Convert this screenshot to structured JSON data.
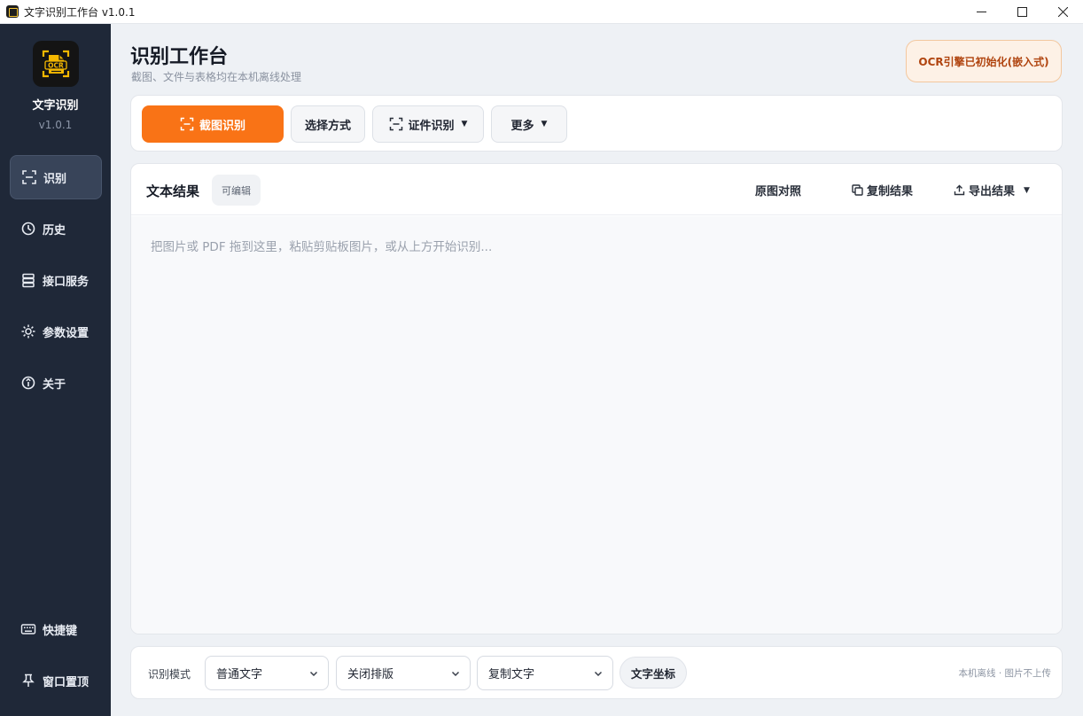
{
  "window": {
    "title": "文字识别工作台 v1.0.1",
    "minimize_icon": "minimize-icon",
    "maximize_icon": "maximize-icon",
    "close_icon": "close-icon"
  },
  "sidebar": {
    "logo_text": "OCR",
    "app_name": "文字识别",
    "version": "v1.0.1",
    "items": [
      {
        "label": "识别",
        "icon": "scan-icon",
        "active": true
      },
      {
        "label": "历史",
        "icon": "history-icon",
        "active": false
      },
      {
        "label": "接口服务",
        "icon": "server-icon",
        "active": false
      },
      {
        "label": "参数设置",
        "icon": "gear-icon",
        "active": false
      },
      {
        "label": "关于",
        "icon": "info-icon",
        "active": false
      }
    ],
    "bottom_items": [
      {
        "label": "快捷键",
        "icon": "keyboard-icon"
      },
      {
        "label": "窗口置顶",
        "icon": "pin-icon"
      }
    ]
  },
  "header": {
    "title": "识别工作台",
    "subtitle": "截图、文件与表格均在本机离线处理",
    "engine_status": "OCR引擎已初始化(嵌入式)"
  },
  "toolbar": {
    "screenshot_label": "截图识别",
    "select_mode_label": "选择方式",
    "id_card_label": "证件识别",
    "more_label": "更多"
  },
  "result": {
    "title": "文本结果",
    "editable_chip": "可编辑",
    "compare_label": "原图对照",
    "copy_label": "复制结果",
    "export_label": "导出结果",
    "placeholder": "把图片或 PDF 拖到这里，粘贴剪贴板图片，或从上方开始识别..."
  },
  "bottom": {
    "mode_label": "识别模式",
    "mode_select": "普通文字",
    "layout_select": "关闭排版",
    "copy_select": "复制文字",
    "coord_label": "文字坐标",
    "footnote": "本机离线 · 图片不上传"
  },
  "colors": {
    "accent": "#f97316",
    "sidebar_bg": "#1f2838",
    "badge_bg": "#fdf1e6",
    "badge_text": "#b0440f"
  }
}
